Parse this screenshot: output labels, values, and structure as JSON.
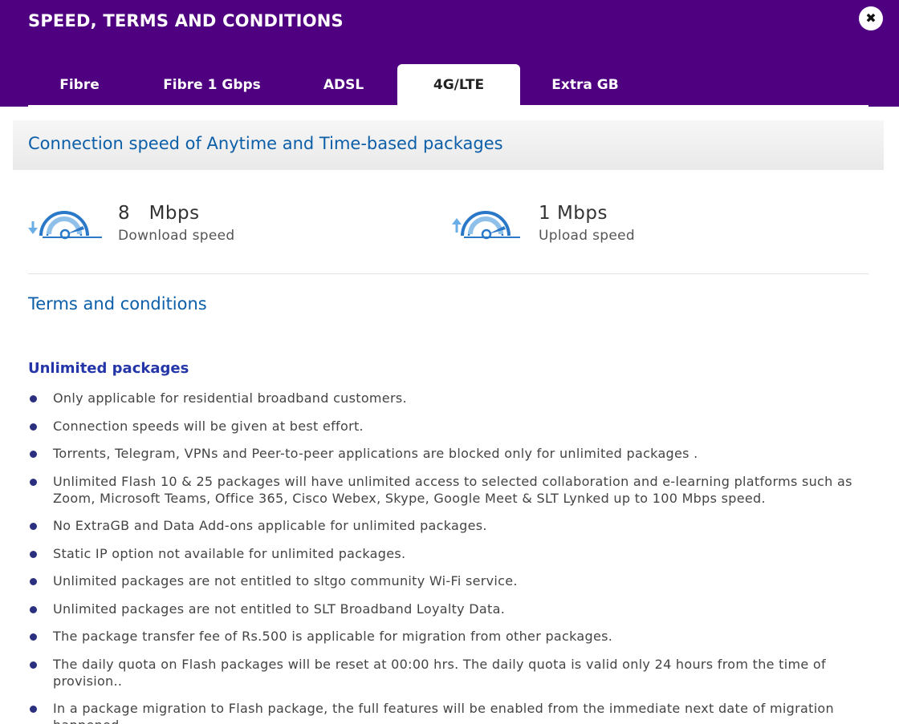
{
  "modal": {
    "title": "SPEED, TERMS AND CONDITIONS",
    "close_icon": "close-icon",
    "close_glyph": "✖"
  },
  "tabs": [
    {
      "label": "Fibre",
      "active": false
    },
    {
      "label": "Fibre 1 Gbps",
      "active": false
    },
    {
      "label": "ADSL",
      "active": false
    },
    {
      "label": "4G/LTE",
      "active": true
    },
    {
      "label": "Extra GB",
      "active": false
    }
  ],
  "speed_section": {
    "title": "Connection speed of Anytime and Time-based packages",
    "download": {
      "value": "8   Mbps",
      "caption": "Download speed",
      "icon": "download-speed-gauge-icon"
    },
    "upload": {
      "value": "1 Mbps",
      "caption": "Upload speed",
      "icon": "upload-speed-gauge-icon"
    }
  },
  "terms": {
    "title": "Terms and conditions",
    "unlimited": {
      "heading": "Unlimited packages",
      "items": [
        "Only applicable for residential broadband customers.",
        "Connection speeds will be given at best effort.",
        "Torrents, Telegram, VPNs and Peer-to-peer applications are blocked only for unlimited packages .",
        "Unlimited Flash 10 & 25 packages will have unlimited access to selected collaboration and e-learning platforms such as Zoom, Microsoft Teams, Office 365, Cisco Webex, Skype, Google Meet & SLT Lynked up to 100 Mbps speed.",
        "No ExtraGB and Data Add-ons applicable for unlimited packages.",
        "Static IP option not available for unlimited packages.",
        "Unlimited packages are not entitled to sltgo community Wi-Fi service.",
        "Unlimited packages are not entitled to SLT Broadband Loyalty Data.",
        "The package transfer fee of Rs.500 is applicable for migration from other packages.",
        "The daily quota on Flash packages will be reset at 00:00 hrs. The daily quota is valid only 24 hours from the time of provision..",
        "In a package migration to Flash package, the full features will be enabled from the immediate next date of migration happened."
      ]
    }
  },
  "colors": {
    "header_purple": "#4f0081",
    "heading_blue": "#0b5ea8",
    "section_blue": "#2435a8",
    "gauge_blue": "#2a78c8",
    "bullet_navy": "#2a2f7f"
  }
}
